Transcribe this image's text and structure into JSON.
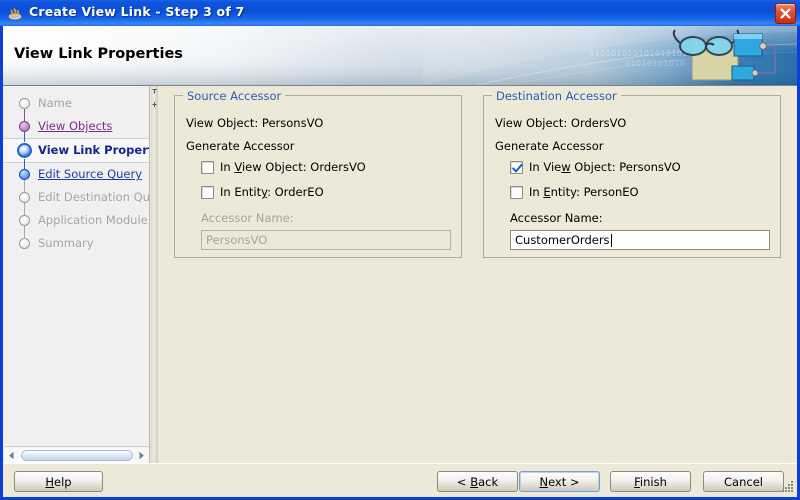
{
  "window": {
    "title": "Create View Link - Step 3 of 7",
    "app_icon": "wizard-coffee-icon",
    "close_icon": "close-icon",
    "accent_blue": "#0b3fd8",
    "titlebar_gradient_from": "#1a63e6",
    "titlebar_gradient_to": "#1f6ae8"
  },
  "header": {
    "page_title": "View Link Properties",
    "banner_icon": "view-link-glasses-icon",
    "banner_digits_1": "010101010101010101010101010101",
    "banner_digits_2": "01010101010"
  },
  "sidebar": {
    "steps": [
      {
        "label": "Name",
        "state": "pending",
        "bullet": "bullet-pending"
      },
      {
        "label": "View Objects",
        "state": "visited",
        "bullet": "bullet-purple"
      },
      {
        "label": "View Link Properties",
        "state": "current",
        "bullet": "bullet-current"
      },
      {
        "label": "Edit Source Query",
        "state": "visited-blue",
        "bullet": "bullet-blue"
      },
      {
        "label": "Edit Destination Query",
        "state": "pending",
        "bullet": "bullet-pending"
      },
      {
        "label": "Application Module",
        "state": "pending",
        "bullet": "bullet-pending"
      },
      {
        "label": "Summary",
        "state": "pending",
        "bullet": "bullet-pending"
      }
    ],
    "scrollbar": {
      "left_arrow_icon": "triangle-left-icon",
      "right_arrow_icon": "triangle-right-icon",
      "thumb_name": "horizontal-scroll-thumb"
    }
  },
  "main": {
    "source": {
      "group_title": "Source Accessor",
      "view_object_line": "View Object: PersonsVO",
      "generate_accessor_label": "Generate Accessor",
      "checkbox_view_object": {
        "prefix": "In ",
        "mnemonic": "V",
        "suffix": "iew Object: OrdersVO",
        "checked": false
      },
      "checkbox_entity": {
        "prefix": "In Entit",
        "mnemonic": "y",
        "suffix": ": OrderEO",
        "checked": false
      },
      "accessor_name_label": "Accessor Name:",
      "accessor_name_value": "PersonsVO",
      "accessor_name_enabled": false
    },
    "destination": {
      "group_title": "Destination Accessor",
      "view_object_line": "View Object: OrdersVO",
      "generate_accessor_label": "Generate Accessor",
      "checkbox_view_object": {
        "prefix": "In Vie",
        "mnemonic": "w",
        "suffix": " Object: PersonsVO",
        "checked": true
      },
      "checkbox_entity": {
        "prefix": "In ",
        "mnemonic": "E",
        "suffix": "ntity: PersonEO",
        "checked": false
      },
      "accessor_name_label": "Accessor Name:",
      "accessor_name_value": "CustomerOrders",
      "accessor_name_enabled": true
    }
  },
  "footer": {
    "help": {
      "prefix": "",
      "mnemonic": "H",
      "suffix": "elp"
    },
    "back": {
      "prefix": "< ",
      "mnemonic": "B",
      "suffix": "ack"
    },
    "next": {
      "prefix": "",
      "mnemonic": "N",
      "suffix": "ext >",
      "is_default": true
    },
    "finish": {
      "prefix": "",
      "mnemonic": "F",
      "suffix": "inish"
    },
    "cancel": {
      "prefix": "Cancel",
      "mnemonic": "",
      "suffix": ""
    },
    "resize_grip_icon": "resize-grip-icon"
  }
}
